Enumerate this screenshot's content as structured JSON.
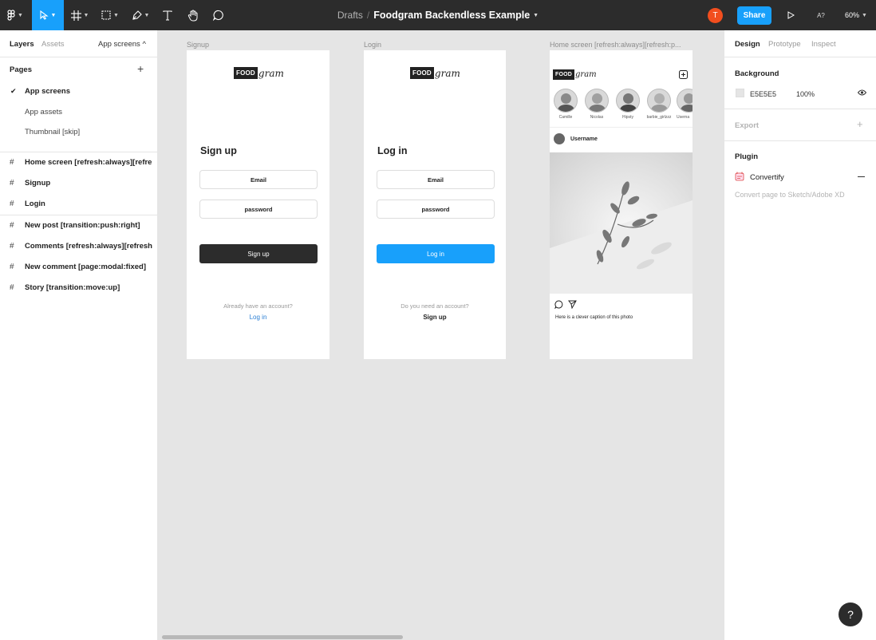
{
  "toolbar": {
    "breadcrumb": "Drafts",
    "separator": "/",
    "file_name": "Foodgram Backendless Example",
    "avatar_initial": "T",
    "share_label": "Share",
    "font_control": "A?",
    "zoom": "60%"
  },
  "left_panel": {
    "tabs": {
      "layers": "Layers",
      "assets": "Assets",
      "page_selector": "App screens ^"
    },
    "pages_label": "Pages",
    "pages": [
      {
        "label": "App screens",
        "selected": true
      },
      {
        "label": "App assets",
        "selected": false
      },
      {
        "label": "Thumbnail [skip]",
        "selected": false
      }
    ],
    "layers": [
      "Home screen [refresh:always][refresh:pull]",
      "Signup",
      "Login",
      "New post [transition:push:right]",
      "Comments [refresh:always][refresh:pull]",
      "New comment [page:modal:fixed]",
      "Story [transition:move:up]"
    ]
  },
  "canvas": {
    "logo_box": "FOOD",
    "logo_script": "gram",
    "signup": {
      "frame_label": "Signup",
      "title": "Sign up",
      "email": "Email",
      "password": "password",
      "button": "Sign up",
      "note": "Already have an account?",
      "link": "Log in"
    },
    "login": {
      "frame_label": "Login",
      "title": "Log in",
      "email": "Email",
      "password": "password",
      "button": "Log in",
      "note": "Do you need an account?",
      "link": "Sign up"
    },
    "home": {
      "frame_label": "Home screen [refresh:always][refresh:p...",
      "stories": [
        "Camille",
        "Nicolas",
        "Hipsty",
        "barbie_girlzzz",
        "Userna"
      ],
      "post_user": "Username",
      "caption": "Here is a clever caption of this photo"
    }
  },
  "right_panel": {
    "tabs": {
      "design": "Design",
      "prototype": "Prototype",
      "inspect": "Inspect"
    },
    "background_label": "Background",
    "background_hex": "E5E5E5",
    "background_opacity": "100%",
    "export_label": "Export",
    "plugin_label": "Plugin",
    "plugin_name": "Convertify",
    "plugin_desc": "Convert page to Sketch/Adobe XD"
  },
  "help": "?",
  "colors": {
    "toolbar": "#2c2c2c",
    "accent": "#18a0fb",
    "canvas": "#e5e5e5",
    "avatar": "#f24e1e",
    "dark_button": "#2c2c2c"
  }
}
